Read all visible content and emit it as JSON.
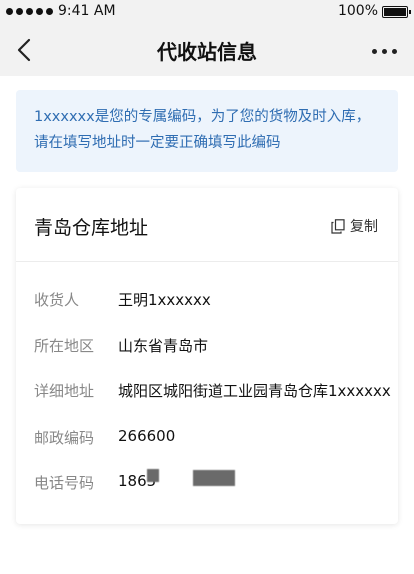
{
  "status_bar": {
    "time": "9:41 AM",
    "battery": "100%"
  },
  "nav": {
    "title": "代收站信息"
  },
  "notice": {
    "line1": "1xxxxxx是您的专属编码，为了您的货物及时入库，",
    "line2": "请在填写地址时一定要正确填写此编码"
  },
  "card": {
    "title": "青岛仓库地址",
    "copy_label": "复制",
    "rows": [
      {
        "label": "收货人",
        "value": "王明1xxxxxx"
      },
      {
        "label": "所在地区",
        "value": "山东省青岛市"
      },
      {
        "label": "详细地址",
        "value": "城阳区城阳街道工业园青岛仓库1xxxxxx"
      },
      {
        "label": "邮政编码",
        "value": "266600"
      },
      {
        "label": "电话号码",
        "value": "1865"
      }
    ]
  },
  "colors": {
    "notice_text": "#2f6db2",
    "notice_bg": "#edf4fc",
    "bar_bg": "#f2f2f2"
  },
  "icons": [
    "signal-dots-icon",
    "battery-icon",
    "back-arrow-icon",
    "more-dots-icon",
    "copy-icon"
  ]
}
